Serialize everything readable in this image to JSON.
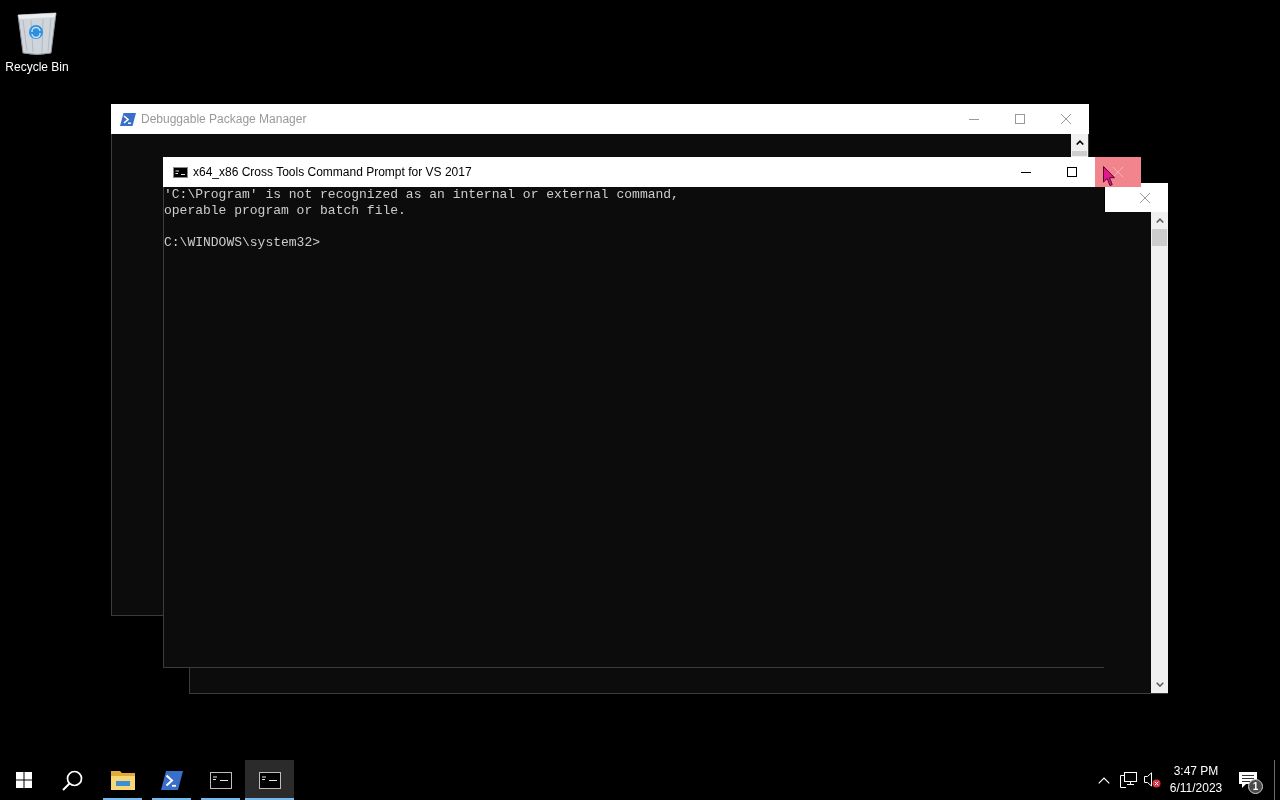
{
  "desktop_icons": [
    {
      "label": "Recycle Bin"
    }
  ],
  "windows": [
    {
      "kind": "powershell",
      "title": "Debuggable Package Manager",
      "active": false,
      "close_hovered": false
    },
    {
      "kind": "console",
      "active": false,
      "close_hovered": false
    },
    {
      "kind": "cmd",
      "title": "x64_x86 Cross Tools Command Prompt for VS 2017",
      "active": true,
      "close_hovered": true,
      "output": "'C:\\Program' is not recognized as an internal or external command,\noperable program or batch file.",
      "prompt": "C:\\WINDOWS\\system32>"
    }
  ],
  "taskbar": {
    "apps": [
      {
        "kind": "folder",
        "running": true,
        "selected": false
      },
      {
        "kind": "powershell",
        "running": true,
        "selected": false
      },
      {
        "kind": "cmd",
        "running": true,
        "selected": false
      },
      {
        "kind": "cmd",
        "running": true,
        "selected": true
      }
    ],
    "time": "3:47 PM",
    "date": "6/11/2023",
    "notification_count": "1"
  }
}
